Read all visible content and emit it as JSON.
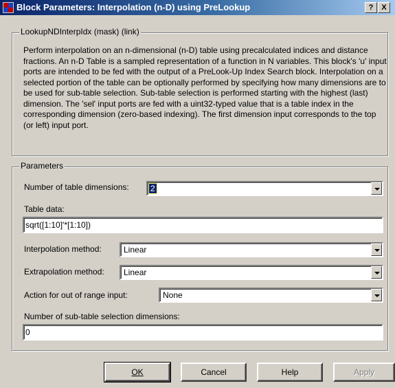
{
  "window": {
    "title": "Block Parameters: Interpolation (n-D) using PreLookup",
    "help_glyph": "?",
    "close_glyph": "X"
  },
  "mask_group": {
    "legend": "LookupNDInterpIdx (mask) (link)",
    "description": "Perform interpolation on an n-dimensional (n-D) table using precalculated indices and distance fractions.  An n-D Table is a sampled representation of a function in N variables.  This block's 'u' input ports are intended to be fed with the output of a PreLook-Up Index Search block.  Interpolation on a selected portion of the table can be optionally performed by specifying how many dimensions are to be used for sub-table selection.  Sub-table selection is performed starting with the highest (last) dimension.  The 'sel' input ports are fed with a uint32-typed value that is a table index in the corresponding dimension (zero-based indexing).  The first dimension input corresponds to the top (or left) input port."
  },
  "parameters": {
    "legend": "Parameters",
    "num_dims_label": "Number of table dimensions:",
    "num_dims_value": "2",
    "table_data_label": "Table data:",
    "table_data_value": "sqrt([1:10]'*[1:10])",
    "interp_label": "Interpolation method:",
    "interp_value": "Linear",
    "extrap_label": "Extrapolation method:",
    "extrap_value": "Linear",
    "action_label": "Action for out of range input:",
    "action_value": "None",
    "subtable_label": "Number of sub-table selection dimensions:",
    "subtable_value": "0"
  },
  "buttons": {
    "ok": "OK",
    "cancel": "Cancel",
    "help": "Help",
    "apply": "Apply"
  },
  "colors": {
    "face": "#d4d0c8",
    "title_start": "#0a246a",
    "title_end": "#a6caf0",
    "selection": "#0a246a"
  }
}
